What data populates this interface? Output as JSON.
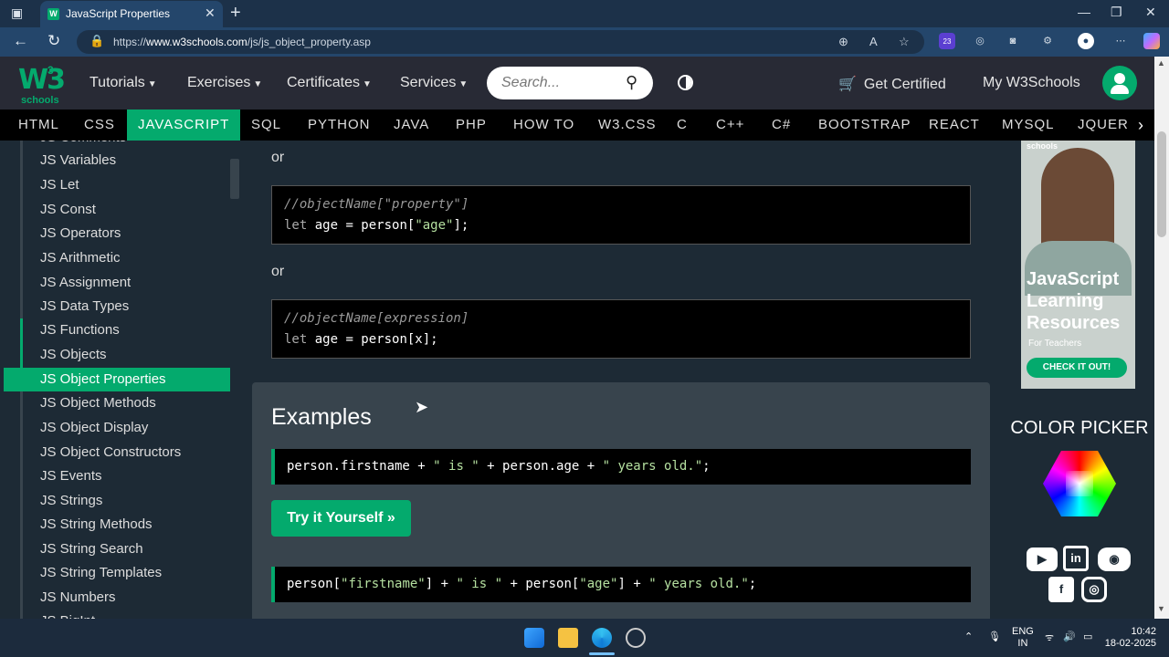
{
  "browser": {
    "tab_title": "JavaScript Properties",
    "tab_favicon": "W",
    "url_prefix": "https://",
    "url_domain": "www.w3schools.com",
    "url_path": "/js/js_object_property.asp",
    "extension_badge": "23"
  },
  "nav": {
    "logo_text": "W3",
    "logo_sup": "3",
    "logo_sub": "schools",
    "menus": [
      "Tutorials",
      "Exercises",
      "Certificates",
      "Services"
    ],
    "search_placeholder": "Search...",
    "get_certified": "Get Certified",
    "my_w3schools": "My W3Schools"
  },
  "languages": [
    "HTML",
    "CSS",
    "JAVASCRIPT",
    "SQL",
    "PYTHON",
    "JAVA",
    "PHP",
    "HOW TO",
    "W3.CSS",
    "C",
    "C++",
    "C#",
    "BOOTSTRAP",
    "REACT",
    "MYSQL",
    "JQUERY"
  ],
  "active_language": "JAVASCRIPT",
  "sidebar": {
    "items": [
      "JS Comments",
      "JS Variables",
      "JS Let",
      "JS Const",
      "JS Operators",
      "JS Arithmetic",
      "JS Assignment",
      "JS Data Types",
      "JS Functions",
      "JS Objects",
      "JS Object Properties",
      "JS Object Methods",
      "JS Object Display",
      "JS Object Constructors",
      "JS Events",
      "JS Strings",
      "JS String Methods",
      "JS String Search",
      "JS String Templates",
      "JS Numbers",
      "JS BigInt"
    ],
    "active": "JS Object Properties"
  },
  "content": {
    "or": "or",
    "code1": {
      "comment": "//objectName[\"property\"]",
      "kw": "let",
      "mid": " age = person[",
      "str": "\"age\"",
      "end": "];"
    },
    "code2": {
      "comment": "//objectName[expression]",
      "kw": "let",
      "rest": " age = person[x];"
    },
    "examples_heading": "Examples",
    "example1": {
      "a": "person.firstname + ",
      "s1": "\" is \"",
      "b": " + person.age + ",
      "s2": "\" years old.\"",
      "c": ";"
    },
    "try_button": "Try it Yourself »",
    "example2": {
      "a": "person[",
      "s1": "\"firstname\"",
      "b": "] + ",
      "s2": "\" is \"",
      "c": " + person[",
      "s3": "\"age\"",
      "d": "] + ",
      "s4": "\" years old.\"",
      "e": ";"
    }
  },
  "ad": {
    "brand": "schools",
    "title": "JavaScript Learning Resources",
    "subtitle": "For Teachers",
    "button": "CHECK IT OUT!"
  },
  "color_picker": {
    "title": "COLOR PICKER"
  },
  "social": {
    "youtube": "▶",
    "linkedin": "in",
    "discord": "◉",
    "facebook": "f",
    "instagram": "◎"
  },
  "taskbar": {
    "lang": "ENG",
    "region": "IN",
    "time": "10:42",
    "date": "18-02-2025"
  },
  "colors": {
    "accent": "#04aa6d",
    "bg": "#1d2a35",
    "nav": "#282a35"
  }
}
